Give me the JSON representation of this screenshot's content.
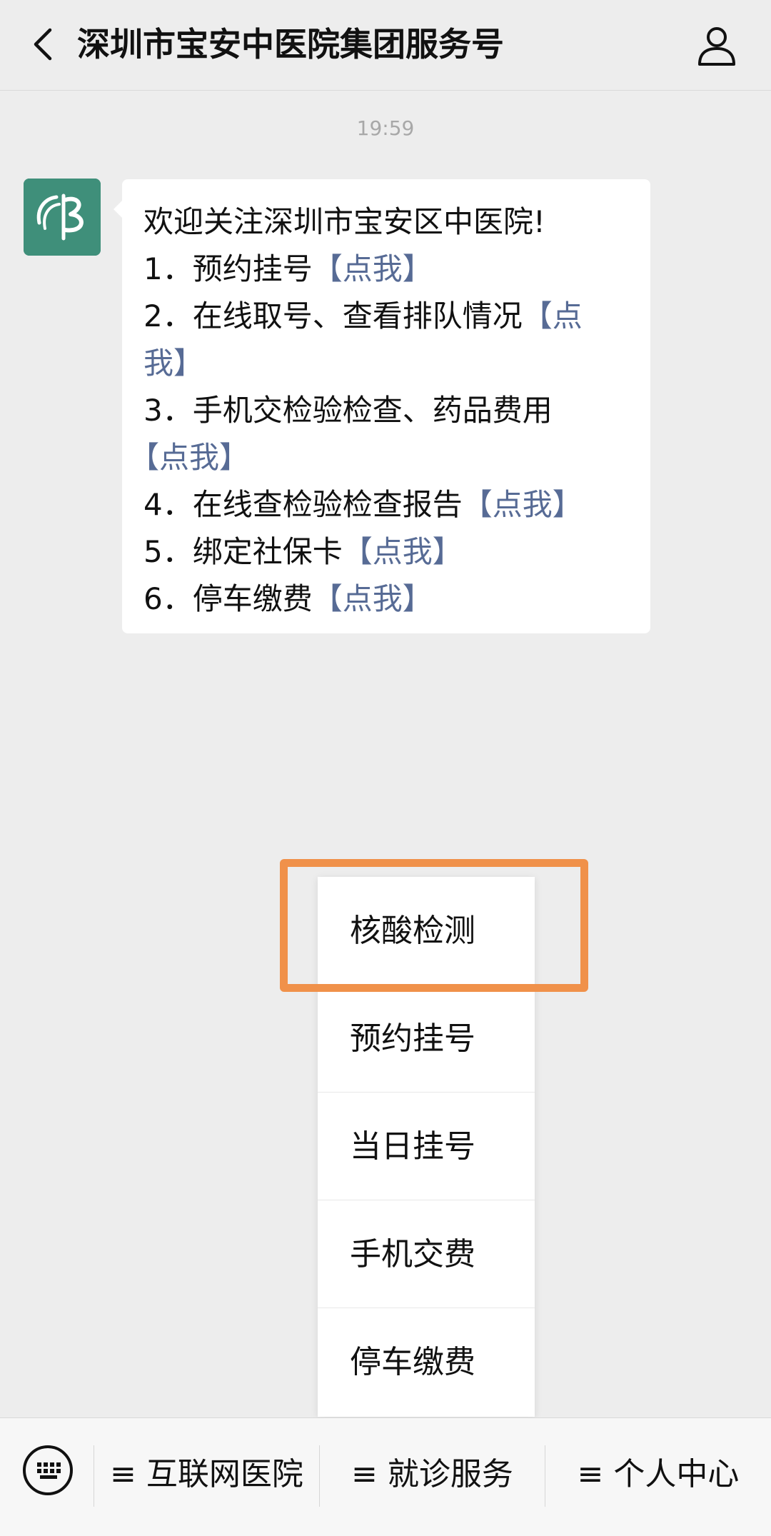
{
  "header": {
    "title": "深圳市宝安中医院集团服务号",
    "back_icon": "chevron-left-icon",
    "profile_icon": "person-icon"
  },
  "chat": {
    "timestamp": "19:59",
    "message": {
      "greeting": "欢迎关注深圳市宝安区中医院!",
      "line1_text": "1．预约挂号",
      "line1_link": "【点我】",
      "line2_text": "2．在线取号、查看排队情况",
      "line2_link_part1": "【点",
      "line2_link_part2": "我】",
      "line3_text": "3．手机交检验检查、药品费用",
      "line3_link": "【点我】",
      "line4_text": "4．在线查检验检查报告",
      "line4_link": "【点我】",
      "line5_text": "5．绑定社保卡",
      "line5_link": "【点我】",
      "line6_text": "6．停车缴费",
      "line6_link": "【点我】"
    }
  },
  "popup_menu": {
    "items": [
      "核酸检测",
      "预约挂号",
      "当日挂号",
      "手机交费",
      "停车缴费"
    ]
  },
  "bottom_menu": {
    "keyboard_icon": "keyboard-icon",
    "items": [
      "≡ 互联网医院",
      "≡ 就诊服务",
      "≡ 个人中心"
    ]
  },
  "colors": {
    "background": "#ededed",
    "link": "#576b95",
    "highlight": "#f0914a",
    "avatar": "#3f8f7a"
  }
}
